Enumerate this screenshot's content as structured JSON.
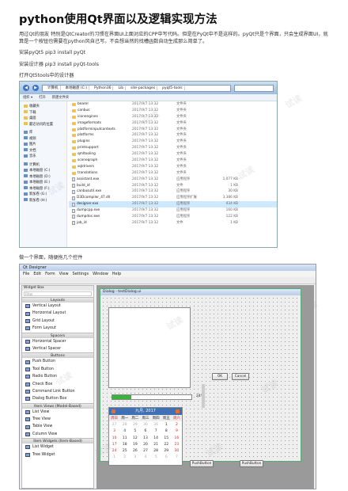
{
  "heading": "python使用Qt界面以及逻辑实现方法",
  "intro": "用过Qt的朋友 特别是QtCreator的习惯在界面UI上面对应的CPP中写代码。但是在PyQt中不是这样的。pyQt只是个界面，只会生成界面UI，就算是一个按钮也需要在python风自己写。不会想当然的找槽函数自动生成那么简单了。",
  "step1": "安装pyQt5 pip3 install pyQt",
  "step2": "安装设计器 pip3 install pyQt-tools",
  "step3": "打开Qt5tools中的设计器",
  "step4": "做一个界面，随便拖几个控件",
  "watermark": "试读",
  "explorer": {
    "breadcrumb": [
      "计算机",
      "本地磁盘 (C:)",
      "Python36",
      "Lib",
      "site-packages",
      "pyqt5-tools"
    ],
    "toolbar": [
      "组织 ▾",
      "打开",
      "新建文件夹"
    ],
    "sidebar": [
      "收藏夹",
      "下载",
      "桌面",
      "最近访问的位置",
      "库",
      "视频",
      "图片",
      "文档",
      "音乐",
      "计算机",
      "本地磁盘 (C:)",
      "本地磁盘 (D:)",
      "本地磁盘 (E:)",
      "本地磁盘 (F:)",
      "新加卷 (G:)",
      "新加卷 (H:)"
    ],
    "files": [
      {
        "name": "bearer",
        "date": "2017/9/7 13:32",
        "type": "文件夹",
        "size": "",
        "kind": "folder"
      },
      {
        "name": "canbus",
        "date": "2017/9/7 13:32",
        "type": "文件夹",
        "size": "",
        "kind": "folder"
      },
      {
        "name": "iconengines",
        "date": "2017/9/7 13:32",
        "type": "文件夹",
        "size": "",
        "kind": "folder"
      },
      {
        "name": "imageformats",
        "date": "2017/9/7 13:32",
        "type": "文件夹",
        "size": "",
        "kind": "folder"
      },
      {
        "name": "platforminputcontexts",
        "date": "2017/9/7 13:32",
        "type": "文件夹",
        "size": "",
        "kind": "folder"
      },
      {
        "name": "platforms",
        "date": "2017/9/7 13:32",
        "type": "文件夹",
        "size": "",
        "kind": "folder"
      },
      {
        "name": "plugins",
        "date": "2017/9/7 13:32",
        "type": "文件夹",
        "size": "",
        "kind": "folder"
      },
      {
        "name": "printsupport",
        "date": "2017/9/7 13:32",
        "type": "文件夹",
        "size": "",
        "kind": "folder"
      },
      {
        "name": "qmltooling",
        "date": "2017/9/7 13:32",
        "type": "文件夹",
        "size": "",
        "kind": "folder"
      },
      {
        "name": "sceneqraph",
        "date": "2017/9/7 13:32",
        "type": "文件夹",
        "size": "",
        "kind": "folder"
      },
      {
        "name": "sqldrivers",
        "date": "2017/9/7 13:32",
        "type": "文件夹",
        "size": "",
        "kind": "folder"
      },
      {
        "name": "translations",
        "date": "2017/9/7 13:32",
        "type": "文件夹",
        "size": "",
        "kind": "folder"
      },
      {
        "name": "assistant.exe",
        "date": "2017/9/7 13:32",
        "type": "应用程序",
        "size": "1,077 KB",
        "kind": "file"
      },
      {
        "name": "build_id",
        "date": "2017/9/7 13:32",
        "type": "文件",
        "size": "1 KB",
        "kind": "file"
      },
      {
        "name": "canbusutil.exe",
        "date": "2017/9/7 13:32",
        "type": "应用程序",
        "size": "30 KB",
        "kind": "file"
      },
      {
        "name": "D3Dcompiler_47.dll",
        "date": "2017/9/7 13:32",
        "type": "应用程序扩展",
        "size": "3,386 KB",
        "kind": "file"
      },
      {
        "name": "designer.exe",
        "date": "2017/9/7 13:32",
        "type": "应用程序",
        "size": "434 KB",
        "kind": "file",
        "selected": true
      },
      {
        "name": "dumpcpp.exe",
        "date": "2017/9/7 13:32",
        "type": "应用程序",
        "size": "160 KB",
        "kind": "file"
      },
      {
        "name": "dumpdoc.exe",
        "date": "2017/9/7 13:32",
        "type": "应用程序",
        "size": "122 KB",
        "kind": "file"
      },
      {
        "name": "job_id",
        "date": "2017/9/7 13:32",
        "type": "文件",
        "size": "1 KB",
        "kind": "file"
      }
    ]
  },
  "designer": {
    "title": "Qt Designer",
    "menu": [
      "File",
      "Edit",
      "Form",
      "View",
      "Settings",
      "Window",
      "Help"
    ],
    "widget_box_title": "Widget Box",
    "filter_placeholder": "Filter",
    "categories": [
      {
        "name": "Layouts",
        "items": [
          "Vertical Layout",
          "Horizontal Layout",
          "Grid Layout",
          "Form Layout"
        ]
      },
      {
        "name": "Spacers",
        "items": [
          "Horizontal Spacer",
          "Vertical Spacer"
        ]
      },
      {
        "name": "Buttons",
        "items": [
          "Push Button",
          "Tool Button",
          "Radio Button",
          "Check Box",
          "Command Link Button",
          "Dialog Button Box"
        ]
      },
      {
        "name": "Item Views (Model-Based)",
        "items": [
          "List View",
          "Tree View",
          "Table View",
          "Column View"
        ]
      },
      {
        "name": "Item Widgets (Item-Based)",
        "items": [
          "List Widget",
          "Tree Widget"
        ]
      }
    ],
    "form_title": "Dialog - testDialog.ui",
    "ok_label": "OK",
    "cancel_label": "Cancel",
    "progress_value": 0.24,
    "progress_label": "24%",
    "pushbutton_label": "PushButton",
    "calendar": {
      "header": "九月,  2017",
      "weekdays": [
        "周日",
        "周一",
        "周二",
        "周三",
        "周四",
        "周五",
        "周六"
      ],
      "weeks": [
        [
          "27",
          "28",
          "29",
          "30",
          "31",
          "1",
          "2"
        ],
        [
          "3",
          "4",
          "5",
          "6",
          "7",
          "8",
          "9"
        ],
        [
          "10",
          "11",
          "12",
          "13",
          "14",
          "15",
          "16"
        ],
        [
          "17",
          "18",
          "19",
          "20",
          "21",
          "22",
          "23"
        ],
        [
          "24",
          "25",
          "26",
          "27",
          "28",
          "29",
          "30"
        ],
        [
          "1",
          "2",
          "3",
          "4",
          "5",
          "6",
          "7"
        ]
      ]
    }
  }
}
